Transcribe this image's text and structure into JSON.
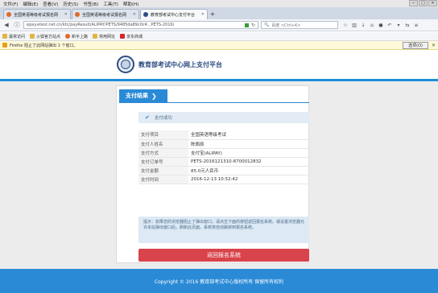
{
  "menubar": {
    "items": [
      "文件(F)",
      "编辑(E)",
      "查看(V)",
      "历史(S)",
      "书签(B)",
      "工具(T)",
      "帮助(H)"
    ],
    "controls": [
      "−",
      "□",
      "✕"
    ]
  },
  "tabs": [
    {
      "label": "全国英语等级考试报名网"
    },
    {
      "label": "全国英语等级考试报名网"
    },
    {
      "label": "教育部考试中心支付平台",
      "active": true
    }
  ],
  "navbar": {
    "url": "epay.etest.net.cn/ktc/payResult/ALIPAY/PETS/9485da89c0c4...PETS-2016)",
    "search_placeholder": "百度 <Ctrl+K>"
  },
  "bookmarks": [
    "最常访问",
    "火狐官方站点",
    "新手上路",
    "常用网址",
    "京东商城"
  ],
  "popup": {
    "text": "Firefox 阻止了此网站弹出 1 个窗口。",
    "options_label": "选项(O)"
  },
  "header": {
    "site_title": "教育部考试中心网上支付平台"
  },
  "card": {
    "section_label": "支付结果",
    "success_text": "支付成功",
    "rows": [
      {
        "label": "支付项目",
        "value": "全国英语等级考试"
      },
      {
        "label": "支付人姓名",
        "value": "陈佩辰"
      },
      {
        "label": "支付方式",
        "value": "支付宝(ALIPAY)"
      },
      {
        "label": "支付订单号",
        "value": "PETS-2016121310-8700012832"
      },
      {
        "label": "支付金额",
        "value": "85.0元人民币"
      },
      {
        "label": "支付时间",
        "value": "2016-12-13 10:52:42"
      }
    ],
    "tip": "提示：如果您的浏览器阻止了弹出窗口，请点击下面的按钮返回报名系统。或设置浏览器允许本站弹出窗口后，刷新此页面，系统将自动跳转到报名系统。",
    "back_button": "返回报名系统"
  },
  "footer": {
    "text": "Copyright © 2016 教育部考试中心版权所有 保留所有权利"
  },
  "colors": {
    "accent_blue": "#2a8ad6",
    "button_red": "#d9434b",
    "title_blue": "#2b4c82"
  }
}
